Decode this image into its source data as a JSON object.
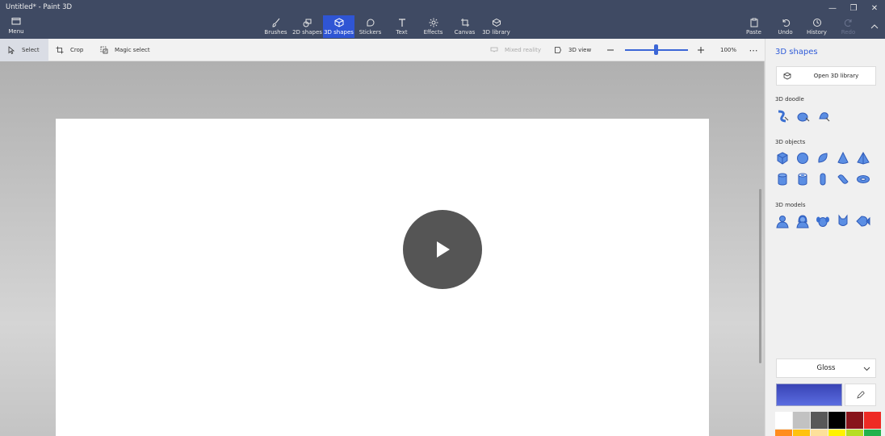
{
  "window": {
    "title": "Untitled* - Paint 3D",
    "controls": [
      "minimize-icon",
      "restore-icon",
      "close-icon"
    ]
  },
  "ribbon": {
    "menu_label": "Menu",
    "tools": [
      {
        "label": "Brushes",
        "icon": "brush-icon"
      },
      {
        "label": "2D shapes",
        "icon": "2d-shapes-icon"
      },
      {
        "label": "3D shapes",
        "icon": "3d-shapes-icon",
        "active": true
      },
      {
        "label": "Stickers",
        "icon": "sticker-icon"
      },
      {
        "label": "Text",
        "icon": "text-icon"
      },
      {
        "label": "Effects",
        "icon": "effects-icon"
      },
      {
        "label": "Canvas",
        "icon": "canvas-icon"
      },
      {
        "label": "3D library",
        "icon": "3d-library-icon"
      }
    ],
    "right_tools": [
      {
        "label": "Paste",
        "icon": "paste-icon"
      },
      {
        "label": "Undo",
        "icon": "undo-icon"
      },
      {
        "label": "History",
        "icon": "history-icon"
      },
      {
        "label": "Redo",
        "icon": "redo-icon",
        "disabled": true
      }
    ]
  },
  "subbar": {
    "select": "Select",
    "crop": "Crop",
    "magic_select": "Magic select",
    "mixed_reality": "Mixed reality",
    "view_3d": "3D view",
    "zoom_level": "100%",
    "zoom_fraction": 0.5
  },
  "panel": {
    "title": "3D shapes",
    "open_library": "Open 3D library",
    "doodle_title": "3D doodle",
    "objects_title": "3D objects",
    "models_title": "3D models",
    "material": "Gloss",
    "current_color": "#4452c8",
    "palette": [
      "#ffffff",
      "#c2c2c2",
      "#585858",
      "#000000",
      "#88141b",
      "#ee2a24",
      "#ff8d1e",
      "#ffc20e",
      "#fde09a",
      "#fff200",
      "#b6dd23",
      "#22b24c"
    ]
  }
}
